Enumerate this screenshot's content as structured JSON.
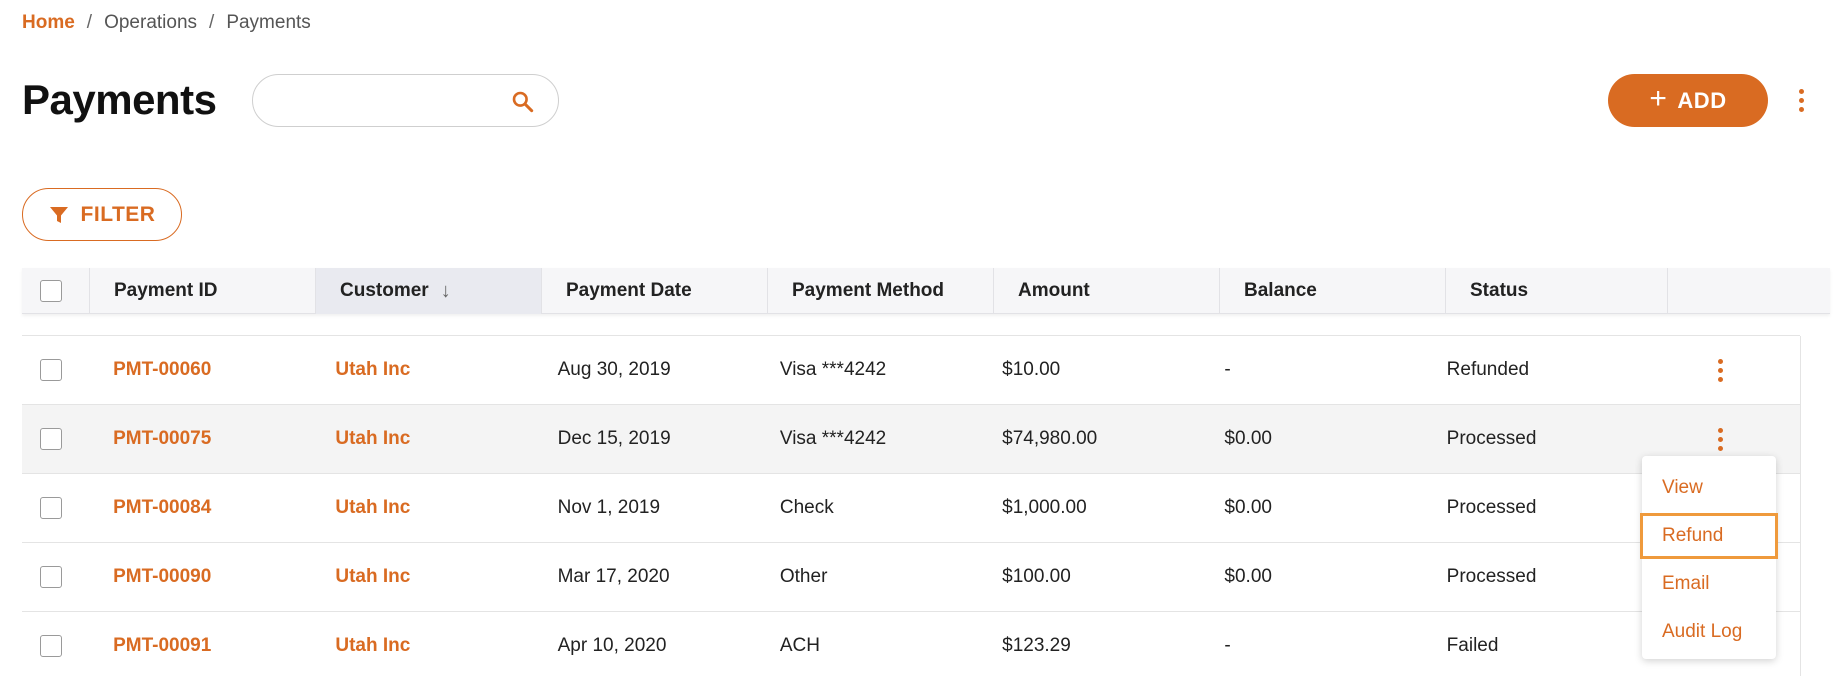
{
  "breadcrumb": {
    "home": "Home",
    "items": [
      "Operations",
      "Payments"
    ],
    "separator": "/"
  },
  "page": {
    "title": "Payments"
  },
  "search": {
    "placeholder": "",
    "value": ""
  },
  "actions": {
    "add_label": "ADD",
    "add_icon": "plus-icon",
    "filter_label": "FILTER",
    "filter_icon": "filter-icon",
    "more_icon": "kebab-icon"
  },
  "colors": {
    "accent": "#d96b22",
    "focus_outline": "#ef9a3c",
    "header_bg": "#f6f6f8",
    "sorted_header_bg": "#e9eaf0",
    "hover_row_bg": "#f4f4f4"
  },
  "table": {
    "columns": [
      "Payment ID",
      "Customer",
      "Payment Date",
      "Payment Method",
      "Amount",
      "Balance",
      "Status"
    ],
    "sorted_column": "Customer",
    "sort_direction": "descending",
    "rows": [
      {
        "id": "PMT-00060",
        "customer": "Utah Inc",
        "date": "Aug 30, 2019",
        "method": "Visa ***4242",
        "amount": "$10.00",
        "balance": "-",
        "status": "Refunded"
      },
      {
        "id": "PMT-00075",
        "customer": "Utah Inc",
        "date": "Dec 15, 2019",
        "method": "Visa ***4242",
        "amount": "$74,980.00",
        "balance": "$0.00",
        "status": "Processed"
      },
      {
        "id": "PMT-00084",
        "customer": "Utah Inc",
        "date": "Nov 1, 2019",
        "method": "Check",
        "amount": "$1,000.00",
        "balance": "$0.00",
        "status": "Processed"
      },
      {
        "id": "PMT-00090",
        "customer": "Utah Inc",
        "date": "Mar 17, 2020",
        "method": "Other",
        "amount": "$100.00",
        "balance": "$0.00",
        "status": "Processed"
      },
      {
        "id": "PMT-00091",
        "customer": "Utah Inc",
        "date": "Apr 10, 2020",
        "method": "ACH",
        "amount": "$123.29",
        "balance": "-",
        "status": "Failed"
      }
    ]
  },
  "row_menu": {
    "items": [
      "View",
      "Refund",
      "Email",
      "Audit Log"
    ],
    "focused": "Refund"
  }
}
